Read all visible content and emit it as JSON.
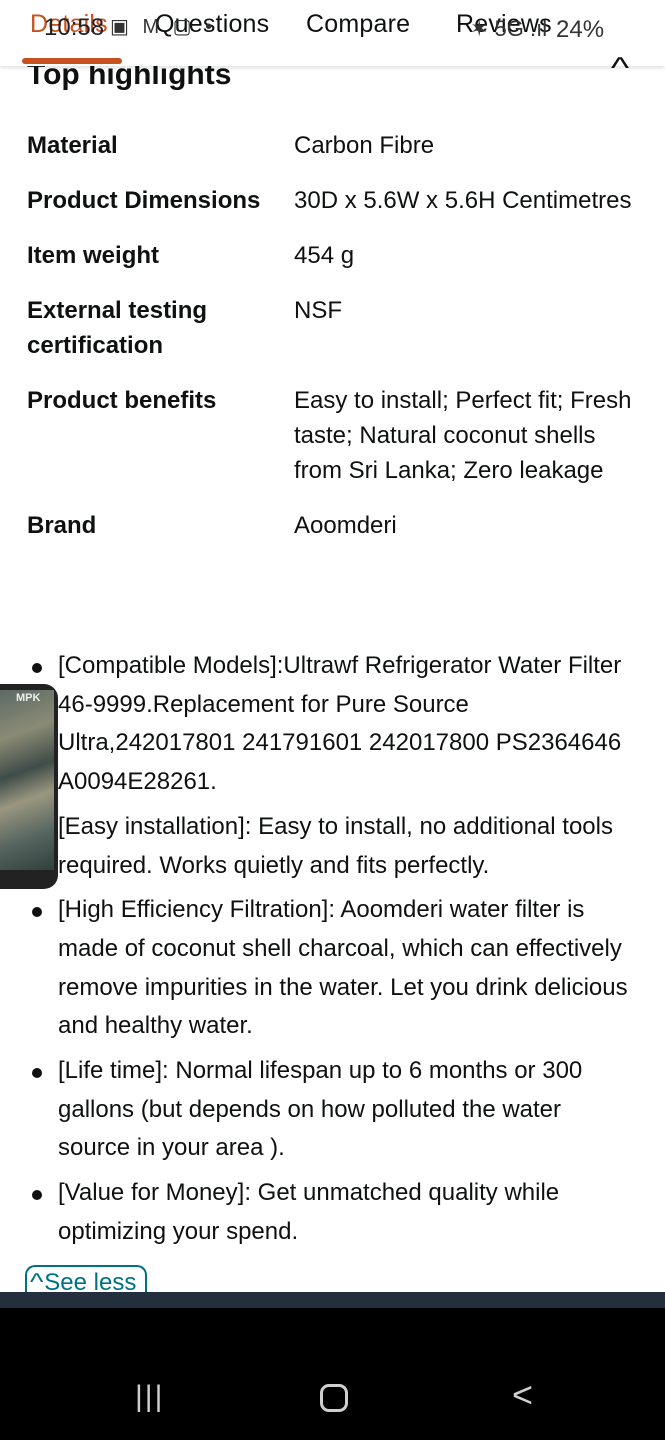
{
  "status_bar": {
    "time": "10:58",
    "icons": "▣ M ▢ •",
    "network": "✶ 5G .ıl",
    "battery": "24%"
  },
  "tabs": [
    {
      "label": "Details",
      "active": true
    },
    {
      "label": "Questions"
    },
    {
      "label": "Compare"
    },
    {
      "label": "Reviews"
    }
  ],
  "colors": {
    "accent": "#c7511f",
    "link": "#007185",
    "text": "#0f1111"
  },
  "back_to_top_icon": "up-arrow-icon",
  "section": {
    "title": "Top highlights",
    "collapse_icon": "chevron-up-icon"
  },
  "specs": [
    {
      "label": "Material",
      "value": "Carbon Fibre"
    },
    {
      "label": "Product Dimensions",
      "value": "30D x 5.6W x 5.6H Centimetres"
    },
    {
      "label": "Item weight",
      "value": "454 g"
    },
    {
      "label": "External testing certification",
      "value": "NSF"
    },
    {
      "label": "Product benefits",
      "value": "Easy to install; Perfect fit; Fresh taste; Natural coconut shells from Sri Lanka; Zero leakage"
    },
    {
      "label": "Brand",
      "value": "Aoomderi"
    }
  ],
  "bullets": [
    "[Compatible Models]:Ultrawf Refrigerator Water Filter 46-9999.Replacement for Pure Source Ultra,242017801 241791601 242017800 PS2364646 A0094E28261.",
    "[Easy installation]: Easy to install, no additional tools required. Works quietly and fits perfectly.",
    "[High Efficiency Filtration]: Aoomderi water filter is made of coconut shell charcoal, which can effectively remove impurities in the water. Let you drink delicious and healthy water.",
    "[Life time]: Normal lifespan up to 6 months or 300 gallons (but depends on how polluted the water source in your area ).",
    "[Value for Money]: Get unmatched quality while optimizing your spend."
  ],
  "see_less": "See less",
  "pip": {
    "tag": "MPK"
  },
  "navbar": {
    "recents_icon": "|||",
    "home_icon": "home-icon",
    "back_icon": "<"
  }
}
